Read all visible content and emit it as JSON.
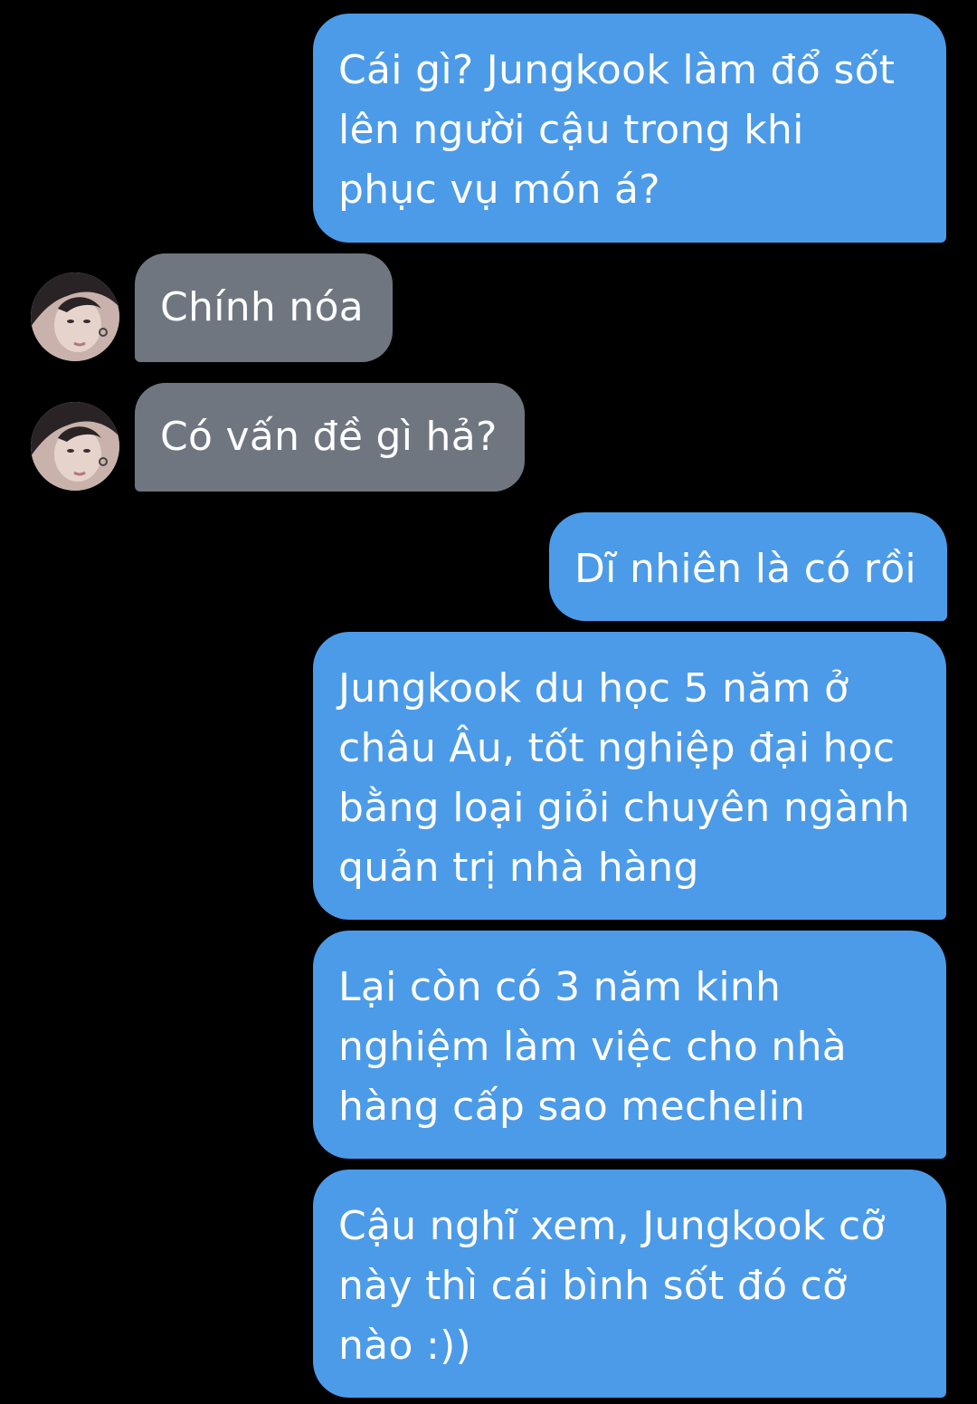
{
  "messages": [
    {
      "side": "sent",
      "text": "Cái gì? Jungkook làm đổ sốt\nlên người cậu trong khi\nphục vụ món á?"
    },
    {
      "side": "received",
      "text": "Chính nóa",
      "avatar_icon": "profile-photo-avatar"
    },
    {
      "side": "received",
      "text": "Có vấn đề gì hả?",
      "avatar_icon": "profile-photo-avatar"
    },
    {
      "side": "sent",
      "text": "Dĩ nhiên là có rồi"
    },
    {
      "side": "sent",
      "text": "Jungkook du học 5 năm ở\nchâu Âu, tốt nghiệp đại học\nbằng loại giỏi chuyên ngành\nquản trị nhà hàng"
    },
    {
      "side": "sent",
      "text": "Lại còn có 3 năm kinh\nnghiệm làm việc cho nhà\nhàng cấp sao mechelin"
    },
    {
      "side": "sent",
      "text": "Cậu nghĩ xem, Jungkook cỡ\nnày thì cái bình sốt đó cỡ\nnào :))"
    }
  ],
  "colors": {
    "background": "#000000",
    "sent_bubble": "#4c9be8",
    "received_bubble": "#6f7680",
    "text": "#ffffff"
  }
}
